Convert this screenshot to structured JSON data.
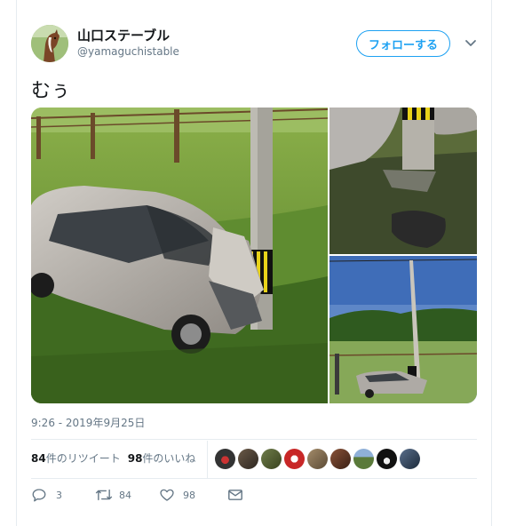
{
  "user": {
    "display_name": "山口ステーブル",
    "handle": "@yamaguchistable",
    "avatar_icon": "horse-avatar"
  },
  "follow_button": {
    "label": "フォローする",
    "color": "#1da1f2"
  },
  "tweet": {
    "text": "むぅ",
    "timestamp": "9:26 - 2019年9月25日",
    "media_count": 3
  },
  "stats": {
    "retweets": {
      "count": "84",
      "label": "件のリツイート"
    },
    "likes": {
      "count": "98",
      "label": "件のいいね"
    },
    "liker_avatar_count": 9
  },
  "actions": {
    "reply": {
      "icon": "reply-icon",
      "count": "3"
    },
    "retweet": {
      "icon": "retweet-icon",
      "count": "84"
    },
    "like": {
      "icon": "heart-icon",
      "count": "98"
    },
    "message": {
      "icon": "envelope-icon"
    }
  }
}
